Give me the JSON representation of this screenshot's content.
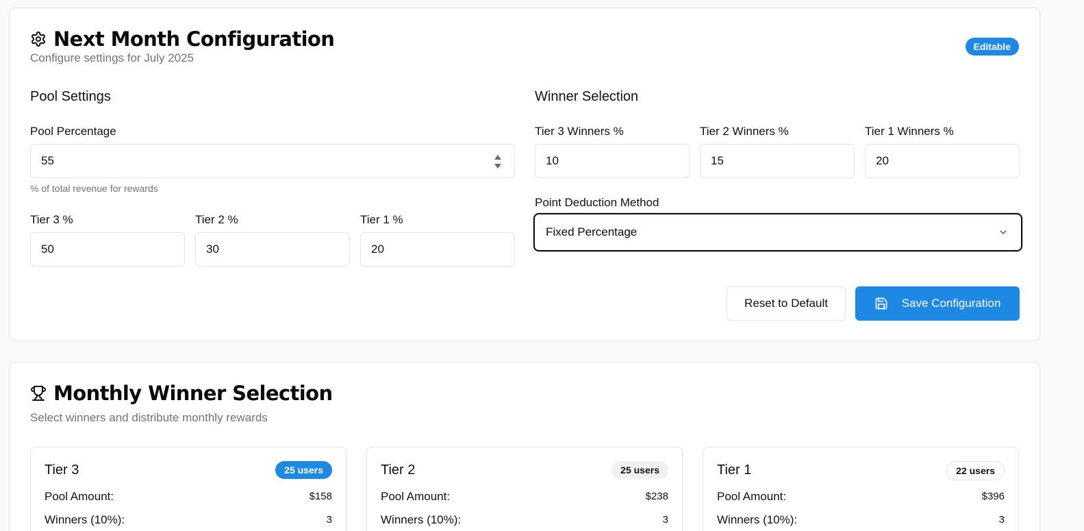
{
  "config": {
    "title": "Next Month Configuration",
    "subtitle": "Configure settings for July 2025",
    "status_badge": "Editable",
    "pool_settings": {
      "heading": "Pool Settings",
      "pool_percentage_label": "Pool Percentage",
      "pool_percentage_value": "55",
      "pool_percentage_hint": "% of total revenue for rewards",
      "tiers": [
        {
          "label": "Tier 3 %",
          "value": "50"
        },
        {
          "label": "Tier 2 %",
          "value": "30"
        },
        {
          "label": "Tier 1 %",
          "value": "20"
        }
      ]
    },
    "winner_selection": {
      "heading": "Winner Selection",
      "tiers": [
        {
          "label": "Tier 3 Winners %",
          "value": "10"
        },
        {
          "label": "Tier 2 Winners %",
          "value": "15"
        },
        {
          "label": "Tier 1 Winners %",
          "value": "20"
        }
      ],
      "deduction_label": "Point Deduction Method",
      "deduction_value": "Fixed Percentage"
    },
    "reset_label": "Reset to Default",
    "save_label": "Save Configuration"
  },
  "winners": {
    "title": "Monthly Winner Selection",
    "subtitle": "Select winners and distribute monthly rewards",
    "tiers": [
      {
        "name": "Tier 3",
        "users": "25 users",
        "pool_label": "Pool Amount:",
        "pool_value": "$158",
        "winners_label": "Winners (10%):",
        "winners_value": "3"
      },
      {
        "name": "Tier 2",
        "users": "25 users",
        "pool_label": "Pool Amount:",
        "pool_value": "$238",
        "winners_label": "Winners (10%):",
        "winners_value": "3"
      },
      {
        "name": "Tier 1",
        "users": "22 users",
        "pool_label": "Pool Amount:",
        "pool_value": "$396",
        "winners_label": "Winners (10%):",
        "winners_value": "3"
      }
    ]
  },
  "colors": {
    "accent": "#1e88e5",
    "muted_text": "#71717a",
    "border": "#e4e4e7"
  },
  "icons": {
    "config_title": "gear-icon",
    "winners_title": "trophy-icon",
    "save": "save-icon",
    "select": "chevron-down-icon",
    "number_spinner": "spinner-arrows-icon"
  }
}
